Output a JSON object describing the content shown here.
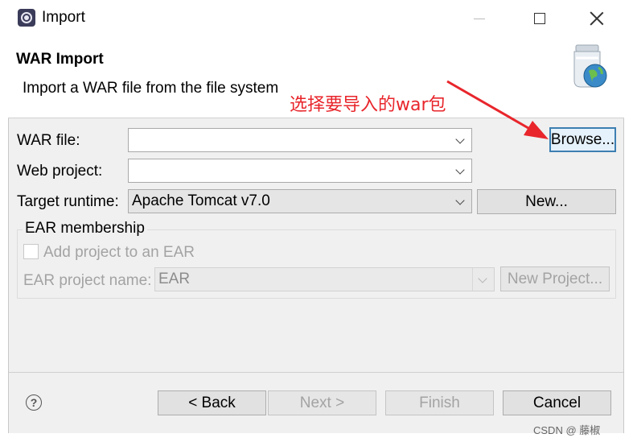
{
  "window": {
    "title": "Import"
  },
  "header": {
    "title": "WAR Import",
    "description": "Import a WAR file from the file system"
  },
  "form": {
    "war_file_label": "WAR file:",
    "war_file_value": "",
    "web_project_label": "Web project:",
    "web_project_value": "",
    "target_runtime_label": "Target runtime:",
    "target_runtime_value": "Apache Tomcat v7.0",
    "browse_label": "Browse...",
    "new_label": "New..."
  },
  "ear": {
    "group_label": "EAR membership",
    "checkbox_label": "Add project to an EAR",
    "checkbox_checked": false,
    "project_name_label": "EAR project name:",
    "project_name_value": "EAR",
    "new_project_label": "New Project..."
  },
  "footer": {
    "back_label": "< Back",
    "next_label": "Next >",
    "finish_label": "Finish",
    "cancel_label": "Cancel"
  },
  "annotation": {
    "text": "选择要导入的war包",
    "color": "#e8262c"
  },
  "watermark": "CSDN @ 藤椒"
}
